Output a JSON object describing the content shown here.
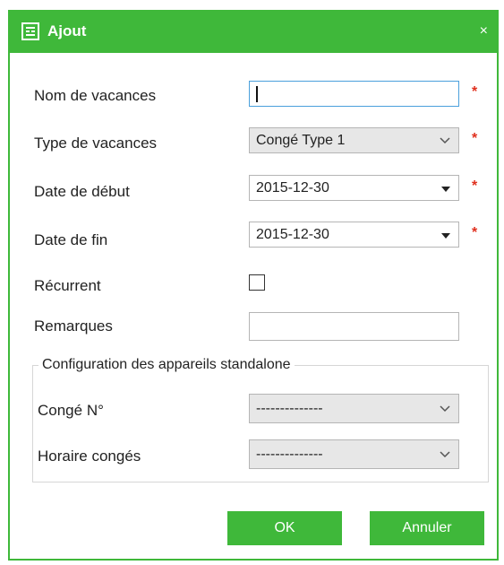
{
  "dialog": {
    "title": "Ajout",
    "close_glyph": "×",
    "title_icon": "form-add-icon",
    "accent_color": "#3fb83a",
    "required_color": "#e0301e"
  },
  "form": {
    "name": {
      "label": "Nom de vacances",
      "value": ""
    },
    "type": {
      "label": "Type de vacances",
      "value": "Congé Type 1"
    },
    "start_date": {
      "label": "Date de début",
      "value": "2015-12-30"
    },
    "end_date": {
      "label": "Date de fin",
      "value": "2015-12-30"
    },
    "recurring": {
      "label": "Récurrent",
      "checked": false
    },
    "remarks": {
      "label": "Remarques",
      "value": ""
    },
    "required_marker": "*"
  },
  "standalone": {
    "legend": "Configuration des appareils standalone",
    "holiday_no": {
      "label": "Congé N°",
      "value": "--------------"
    },
    "holiday_schedule": {
      "label": "Horaire congés",
      "value": "--------------"
    }
  },
  "buttons": {
    "ok": "OK",
    "cancel": "Annuler"
  }
}
